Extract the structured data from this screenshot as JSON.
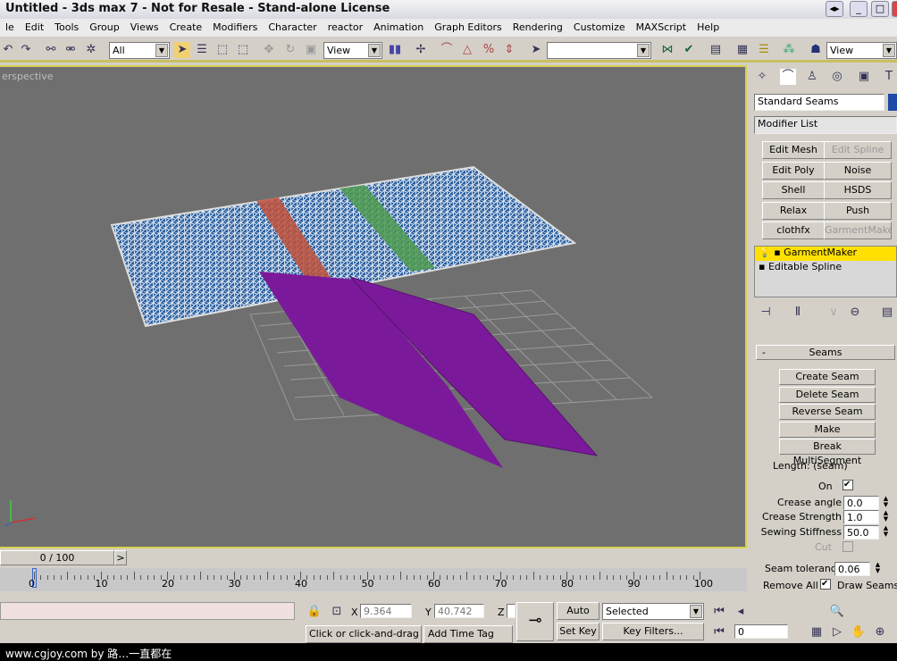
{
  "window": {
    "title": "Untitled - 3ds max 7  - Not for Resale - Stand-alone License"
  },
  "menu": [
    "le",
    "Edit",
    "Tools",
    "Group",
    "Views",
    "Create",
    "Modifiers",
    "Character",
    "reactor",
    "Animation",
    "Graph Editors",
    "Rendering",
    "Customize",
    "MAXScript",
    "Help"
  ],
  "toolbar": {
    "selection_filter": "All",
    "ref_coord": "View",
    "named_selection": "",
    "render_view": "View"
  },
  "viewport": {
    "label": "erspective",
    "colors": {
      "background": "#6f6f6f",
      "cloth": "#2a5f9e",
      "seam_red": "#c0503a",
      "seam_green": "#4e9a4e",
      "pattern": "#7a1a9a",
      "border": "#d8cf50"
    }
  },
  "panel": {
    "object_name": "Standard Seams",
    "modifier_list": "Modifier List",
    "modifier_buttons": [
      {
        "label": "Edit Mesh",
        "enabled": true
      },
      {
        "label": "Edit Spline",
        "enabled": false
      },
      {
        "label": "Edit Poly",
        "enabled": true
      },
      {
        "label": "Noise",
        "enabled": true
      },
      {
        "label": "Shell",
        "enabled": true
      },
      {
        "label": "HSDS",
        "enabled": true
      },
      {
        "label": "Relax",
        "enabled": true
      },
      {
        "label": "Push",
        "enabled": true
      },
      {
        "label": "clothfx",
        "enabled": true
      },
      {
        "label": "GarmentMaker",
        "enabled": false
      }
    ],
    "stack": [
      {
        "label": "GarmentMaker",
        "selected": true
      },
      {
        "label": "Editable Spline",
        "selected": false
      }
    ],
    "rollout": {
      "title": "Seams",
      "collapse": "-",
      "buttons": [
        "Create Seam",
        "Delete Seam",
        "Reverse Seam",
        "Make MultiSegment",
        "Break MultiSegment"
      ],
      "length_label": "Length: (seam)",
      "on_label": "On",
      "on_checked": true,
      "crease_angle_label": "Crease angle",
      "crease_angle": "0.0",
      "crease_strength_label": "Crease Strength",
      "crease_strength": "1.0",
      "sewing_stiffness_label": "Sewing Stiffness",
      "sewing_stiffness": "50.0",
      "cut_label": "Cut",
      "cut_checked": false,
      "seam_tolerance_label": "Seam tolerance",
      "seam_tolerance": "0.06",
      "remove_all": "Remove All",
      "draw_seams_label": "Draw Seams",
      "draw_seams_checked": true
    }
  },
  "timeline": {
    "slider": "0 / 100",
    "ticks": [
      "0",
      "10",
      "20",
      "30",
      "40",
      "50",
      "60",
      "70",
      "80",
      "90",
      "100"
    ],
    "next": ">"
  },
  "status": {
    "x_label": "X",
    "x": "9.364",
    "y_label": "Y",
    "y": "40.742",
    "z_label": "Z",
    "prompt": "Click or click-and-drag to s",
    "add_time_tag": "Add Time Tag",
    "auto_key": "Auto Key",
    "set_key": "Set Key",
    "key_mode": "Selected",
    "key_filters": "Key Filters...",
    "frame": "0"
  },
  "credit": "www.cgjoy.com by 路…一直都在"
}
